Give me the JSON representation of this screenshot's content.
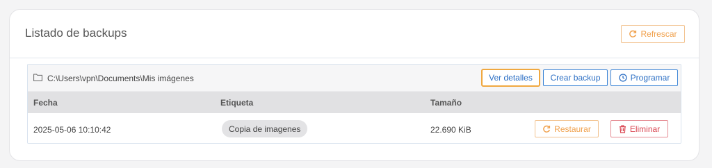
{
  "panel": {
    "title": "Listado de backups",
    "refresh_label": "Refrescar"
  },
  "backup": {
    "path": "C:\\Users\\vpn\\Documents\\Mis imágenes",
    "details_label": "Ver detalles",
    "create_label": "Crear backup",
    "schedule_label": "Programar"
  },
  "table": {
    "headers": [
      "Fecha",
      "Etiqueta",
      "Tamaño"
    ],
    "rows": [
      {
        "date": "2025-05-06 10:10:42",
        "label": "Copia de imagenes",
        "size": "22.690 KiB",
        "restore_label": "Restaurar",
        "delete_label": "Eliminar"
      }
    ]
  },
  "colors": {
    "accent_orange": "#f0a04b",
    "accent_blue": "#2c6fc4",
    "danger_red": "#d9434f"
  },
  "icons": [
    "refresh-icon",
    "folder-icon",
    "clock-icon",
    "trash-icon"
  ]
}
